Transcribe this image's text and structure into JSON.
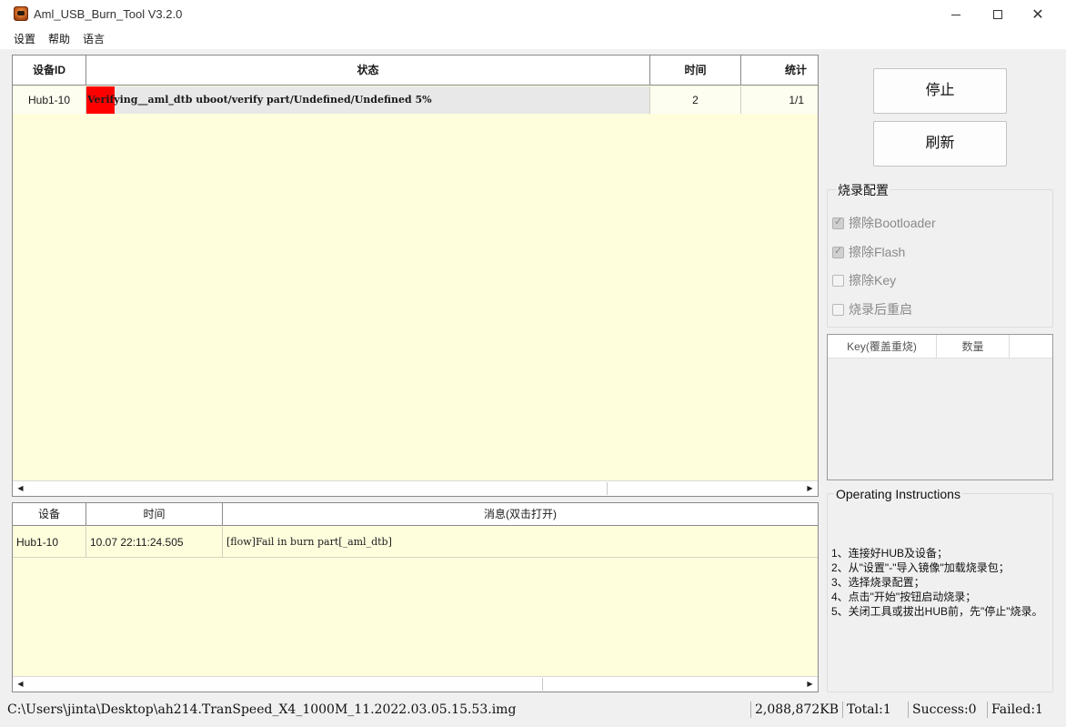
{
  "window": {
    "title": "Aml_USB_Burn_Tool V3.2.0",
    "icon": "app-icon"
  },
  "menu": [
    "设置",
    "帮助",
    "语言"
  ],
  "device_table": {
    "headers": [
      "设备ID",
      "状态",
      "时间",
      "统计"
    ],
    "rows": [
      {
        "device_id": "Hub1-10",
        "status": "Verifying__aml_dtb uboot/verify part/Undefined/Undefined 5%",
        "progress_percent": 5,
        "progress_color": "#ff0000",
        "time": "2",
        "stats": "1/1"
      }
    ]
  },
  "log_table": {
    "headers": [
      "设备",
      "时间",
      "消息(双击打开)"
    ],
    "rows": [
      {
        "device": "Hub1-10",
        "time": "10.07 22:11:24.505",
        "message": "[flow]Fail in burn part[_aml_dtb]"
      }
    ]
  },
  "buttons": {
    "stop": "停止",
    "refresh": "刷新"
  },
  "burn_config": {
    "title": "烧录配置",
    "options": [
      {
        "label": "擦除Bootloader",
        "checked": true
      },
      {
        "label": "擦除Flash",
        "checked": true
      },
      {
        "label": "擦除Key",
        "checked": false
      },
      {
        "label": "烧录后重启",
        "checked": false
      }
    ]
  },
  "key_table": {
    "headers": [
      "Key(覆盖重烧)",
      "数量"
    ]
  },
  "instructions": {
    "title": "Operating Instructions",
    "lines": [
      "1、连接好HUB及设备；",
      "2、从\"设置\"-\"导入镜像\"加载烧录包；",
      "3、选择烧录配置；",
      "4、点击\"开始\"按钮启动烧录；",
      "5、关闭工具或拔出HUB前，先\"停止\"烧录。"
    ]
  },
  "statusbar": {
    "path": "C:\\Users\\jinta\\Desktop\\ah214.TranSpeed_X4_1000M_11.2022.03.05.15.53.img",
    "size": "2,088,872KB",
    "total": "Total:1",
    "success": "Success:0",
    "failed": "Failed:1"
  }
}
